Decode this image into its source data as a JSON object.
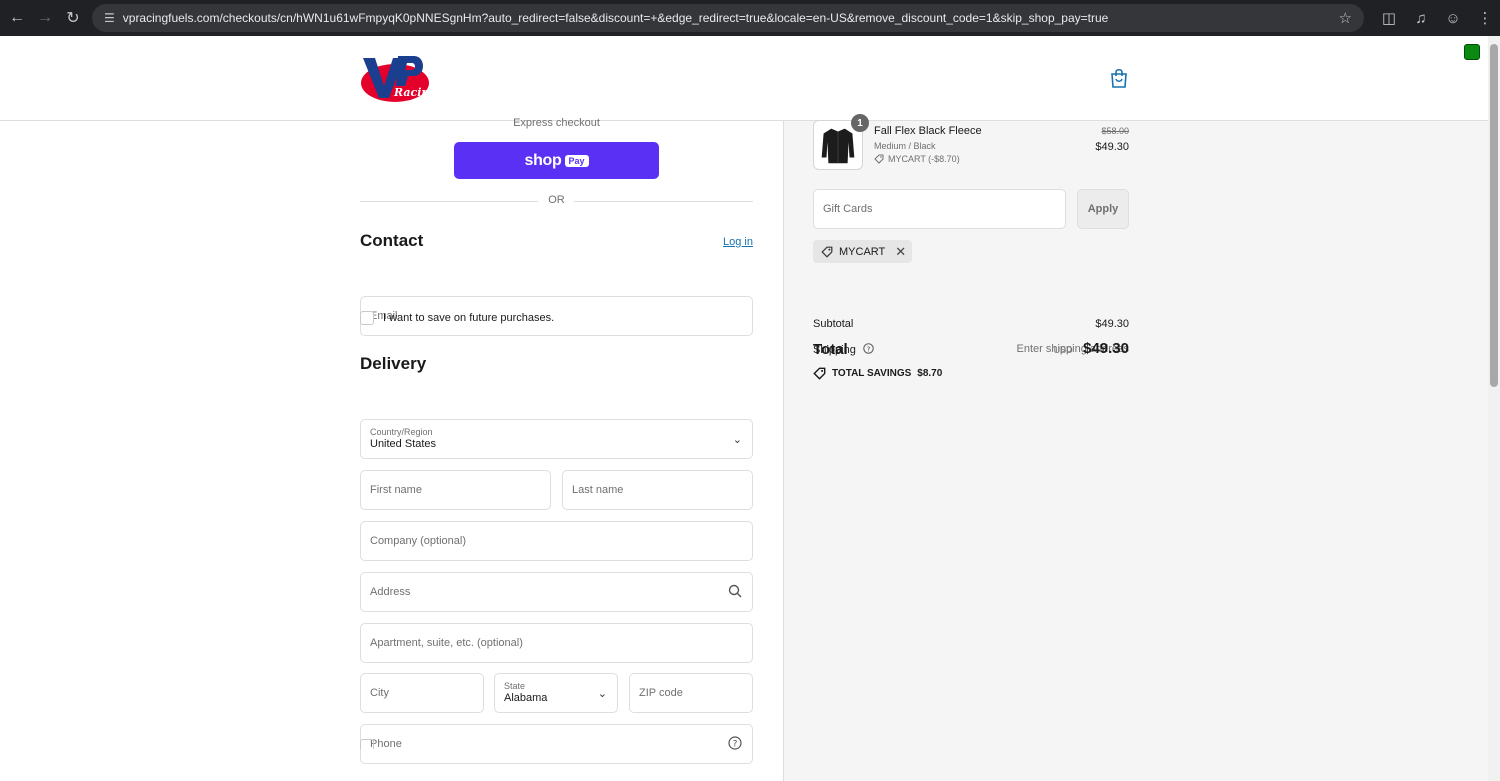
{
  "browser": {
    "url": "vpracingfuels.com/checkouts/cn/hWN1u61wFmpyqK0pNNESgnHm?auto_redirect=false&discount=+&edge_redirect=true&locale=en-US&remove_discount_code=1&skip_shop_pay=true"
  },
  "express": {
    "label": "Express checkout",
    "shop_word": "shop",
    "pay_word": "Pay",
    "or_label": "OR"
  },
  "contact": {
    "heading": "Contact",
    "login_label": "Log in",
    "email_placeholder": "Email",
    "save_label": "I want to save on future purchases."
  },
  "delivery": {
    "heading": "Delivery",
    "country_label": "Country/Region",
    "country_value": "United States",
    "first_name_placeholder": "First name",
    "last_name_placeholder": "Last name",
    "company_placeholder": "Company (optional)",
    "address_placeholder": "Address",
    "apartment_placeholder": "Apartment, suite, etc. (optional)",
    "city_placeholder": "City",
    "state_label": "State",
    "state_value": "Alabama",
    "zip_placeholder": "ZIP code",
    "phone_placeholder": "Phone"
  },
  "order": {
    "item": {
      "quantity": "1",
      "name": "Fall Flex Black Fleece",
      "variant": "Medium / Black",
      "discount": "MYCART (-$8.70)",
      "price_original": "$58.00",
      "price_final": "$49.30"
    },
    "gift_placeholder": "Gift Cards",
    "apply_label": "Apply",
    "applied_code": "MYCART",
    "subtotal_label": "Subtotal",
    "subtotal_value": "$49.30",
    "shipping_label": "Shipping",
    "shipping_value": "Enter shipping address",
    "total_label": "Total",
    "currency": "USD",
    "total_value": "$49.30",
    "savings_label": "TOTAL SAVINGS",
    "savings_value": "$8.70"
  },
  "colors": {
    "shop_pay": "#5a31f4",
    "link": "#1773b0",
    "summary_bg": "#f5f5f5"
  }
}
